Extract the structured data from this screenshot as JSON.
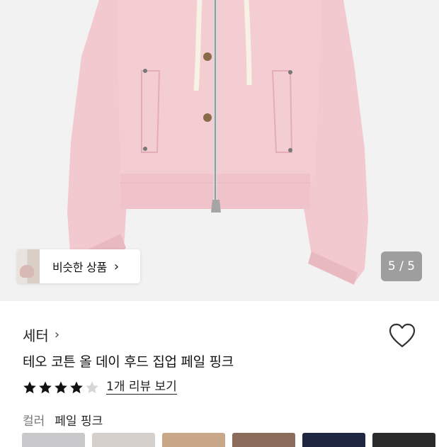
{
  "hero": {
    "similar_products_label": "비슷한 상품",
    "page_indicator": "5 / 5"
  },
  "product": {
    "category": "세터",
    "title": "테오 코튼 올 데이 후드 집업 페일 핑크",
    "rating": 4,
    "rating_max": 5,
    "review_link": "1개 리뷰 보기",
    "color_label": "컬러",
    "color_value": "페일 핑크"
  },
  "swatches": [
    {
      "name": "swatch-1",
      "color": "#c9c9cb"
    },
    {
      "name": "swatch-2",
      "color": "#d6d0cc"
    },
    {
      "name": "swatch-3",
      "color": "#c8a888"
    },
    {
      "name": "swatch-4",
      "color": "#8b6b5a"
    },
    {
      "name": "swatch-5",
      "color": "#1f2740"
    },
    {
      "name": "swatch-6",
      "color": "#2b2b2b"
    }
  ],
  "colors": {
    "jacket": "#f2c9cf",
    "jacket_shadow": "#e7b3bb",
    "star_filled": "#111111",
    "star_empty": "#d6d6d6"
  }
}
